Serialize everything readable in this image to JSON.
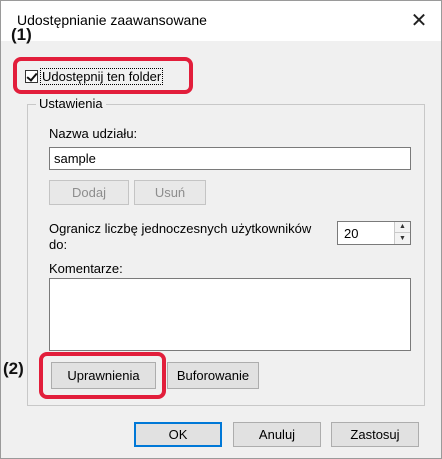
{
  "window": {
    "title": "Udostępnianie zaawansowane",
    "close_glyph": "✕"
  },
  "share_checkbox": {
    "label": "Udostępnij ten folder",
    "checked": true
  },
  "settings": {
    "group_label": "Ustawienia",
    "share_name_label": "Nazwa udziału:",
    "share_name_value": "sample",
    "add_button": "Dodaj",
    "remove_button": "Usuń",
    "limit_label_line1": "Ogranicz liczbę jednoczesnych użytkowników",
    "limit_label_line2": "do:",
    "limit_value": "20",
    "comments_label": "Komentarze:",
    "comments_value": "",
    "permissions_button": "Uprawnienia",
    "caching_button": "Buforowanie"
  },
  "footer": {
    "ok_button": "OK",
    "cancel_button": "Anuluj",
    "apply_button": "Zastosuj"
  },
  "callouts": {
    "one": "(1)",
    "two": "(2)"
  },
  "colors": {
    "highlight": "#e21e3b",
    "focus_blue": "#0078d7",
    "dialog_bg": "#f0f0f0"
  }
}
